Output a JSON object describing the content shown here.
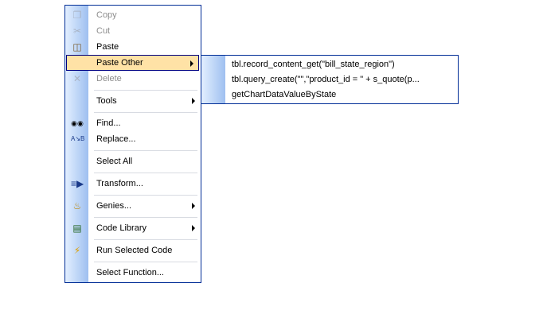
{
  "context_menu": {
    "items": [
      {
        "label": "Copy",
        "icon": "copy-icon",
        "disabled": true
      },
      {
        "label": "Cut",
        "icon": "cut-icon",
        "disabled": true
      },
      {
        "label": "Paste",
        "icon": "paste-icon",
        "disabled": false
      },
      {
        "label": "Paste Other",
        "icon": "",
        "disabled": false,
        "highlighted": true,
        "submenu": true
      },
      {
        "label": "Delete",
        "icon": "delete-icon",
        "disabled": true
      },
      {
        "label": "Tools",
        "icon": "",
        "disabled": false,
        "submenu": true
      },
      {
        "label": "Find...",
        "icon": "binoculars-icon",
        "disabled": false
      },
      {
        "label": "Replace...",
        "icon": "replace-icon",
        "disabled": false
      },
      {
        "label": "Select All",
        "icon": "",
        "disabled": false
      },
      {
        "label": "Transform...",
        "icon": "transform-icon",
        "disabled": false
      },
      {
        "label": "Genies...",
        "icon": "genie-lamp-icon",
        "disabled": false,
        "submenu": true
      },
      {
        "label": "Code Library",
        "icon": "book-icon",
        "disabled": false,
        "submenu": true
      },
      {
        "label": "Run Selected Code",
        "icon": "lightning-icon",
        "disabled": false
      },
      {
        "label": "Select Function...",
        "icon": "",
        "disabled": false
      }
    ]
  },
  "paste_other_submenu": {
    "items": [
      "tbl.record_content_get(\"bill_state_region\")",
      "tbl.query_create(\"\",\"product_id = \" + s_quote(p...",
      "getChartDataValueByState"
    ]
  },
  "colors": {
    "menu_border": "#002d96",
    "highlight_bg": "#ffe2a6",
    "gutter_dark": "#9ebff0",
    "gutter_light": "#e3efff",
    "disabled_text": "#8d8d8d"
  }
}
